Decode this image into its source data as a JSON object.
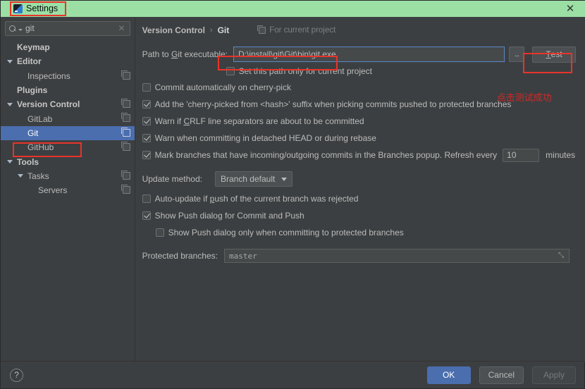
{
  "window": {
    "title": "Settings",
    "app_icon": "intellij-app-icon",
    "close_label": "✕"
  },
  "sidebar": {
    "search": {
      "value": "git",
      "placeholder": "Search settings",
      "clear_label": "✕"
    },
    "items": [
      {
        "label": "Keymap",
        "indent": 0,
        "arrow": "none",
        "bold": true,
        "scope_icon": false,
        "selected": false
      },
      {
        "label": "Editor",
        "indent": 0,
        "arrow": "down",
        "bold": true,
        "scope_icon": false,
        "selected": false
      },
      {
        "label": "Inspections",
        "indent": 1,
        "arrow": "none",
        "bold": false,
        "scope_icon": true,
        "selected": false
      },
      {
        "label": "Plugins",
        "indent": 0,
        "arrow": "none",
        "bold": true,
        "scope_icon": false,
        "selected": false
      },
      {
        "label": "Version Control",
        "indent": 0,
        "arrow": "down",
        "bold": true,
        "scope_icon": true,
        "selected": false
      },
      {
        "label": "GitLab",
        "indent": 1,
        "arrow": "none",
        "bold": false,
        "scope_icon": true,
        "selected": false
      },
      {
        "label": "Git",
        "indent": 1,
        "arrow": "none",
        "bold": false,
        "scope_icon": true,
        "selected": true
      },
      {
        "label": "GitHub",
        "indent": 1,
        "arrow": "none",
        "bold": false,
        "scope_icon": true,
        "selected": false
      },
      {
        "label": "Tools",
        "indent": 0,
        "arrow": "down",
        "bold": true,
        "scope_icon": false,
        "selected": false
      },
      {
        "label": "Tasks",
        "indent": 1,
        "arrow": "down",
        "bold": false,
        "scope_icon": true,
        "selected": false
      },
      {
        "label": "Servers",
        "indent": 2,
        "arrow": "none",
        "bold": false,
        "scope_icon": true,
        "selected": false
      }
    ]
  },
  "main": {
    "breadcrumb": {
      "parent": "Version Control",
      "separator": "›",
      "current": "Git"
    },
    "for_current_project": "For current project",
    "path": {
      "label_pre": "Path to ",
      "label_mnemonic": "G",
      "label_post": "it executable:",
      "value": "D:\\install\\git\\Git\\bin\\git.exe",
      "browse_label": "...",
      "test_label_mnemonic": "T",
      "test_label_rest": "est"
    },
    "set_path_only": {
      "label": "Set this path only for current project",
      "checked": false
    },
    "options": [
      {
        "label": "Commit automatically on cherry-pick",
        "checked": false
      },
      {
        "label": "Add the 'cherry-picked from <hash>' suffix when picking commits pushed to protected branches",
        "checked": true
      },
      {
        "label_pre": "Warn if ",
        "label_mnemonic": "C",
        "label_post": "RLF line separators are about to be committed",
        "checked": true
      },
      {
        "label": "Warn when committing in detached HEAD or during rebase",
        "checked": true
      }
    ],
    "mark_branches": {
      "label": "Mark branches that have incoming/outgoing commits in the Branches popup.  Refresh every",
      "checked": true,
      "interval": "10",
      "unit": "minutes"
    },
    "update_method": {
      "label": "Update method:",
      "value": "Branch default"
    },
    "auto_update": {
      "label_pre": "Auto-update if ",
      "label_mnemonic": "p",
      "label_post": "ush of the current branch was rejected",
      "checked": false
    },
    "show_push_dialog": {
      "label": "Show Push dialog for Commit and Push",
      "checked": true
    },
    "show_push_dialog_protected": {
      "label": "Show Push dialog only when committing to protected branches",
      "checked": false
    },
    "protected_branches": {
      "label": "Protected branches:",
      "value": "master",
      "expand_label": "⤡"
    }
  },
  "annotation": {
    "text": "点击测试成功",
    "color": "#cf2a2a"
  },
  "footer": {
    "help_label": "?",
    "ok_label": "OK",
    "cancel_label": "Cancel",
    "apply_label": "Apply"
  },
  "colors": {
    "titlebar": "#9bdfa5",
    "panel_bg": "#3c3f41",
    "selection": "#4b6eaf",
    "highlight_box": "#e8342a",
    "field_border_focus": "#5a87c7"
  }
}
